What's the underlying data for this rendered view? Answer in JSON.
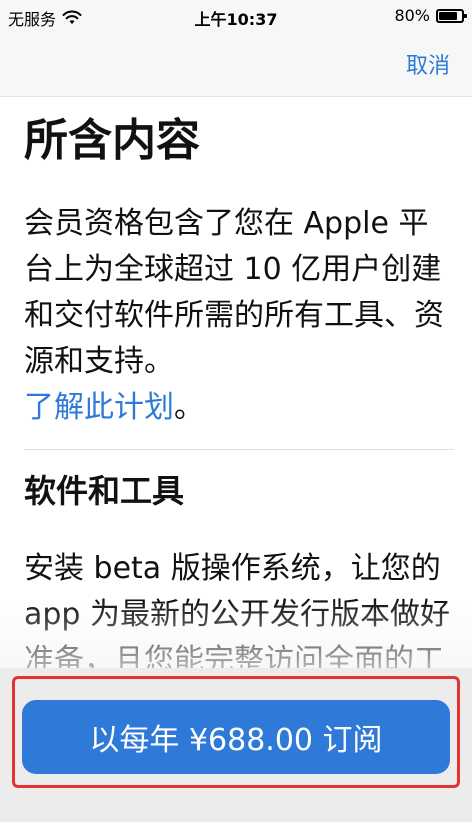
{
  "status_bar": {
    "carrier": "无服务",
    "time": "上午10:37",
    "battery": "80%",
    "battery_level": 0.8
  },
  "nav": {
    "cancel_label": "取消"
  },
  "content": {
    "title": "所含内容",
    "intro_paragraph": "会员资格包含了您在 Apple 平台上为全球超过 10 亿用户创建和交付软件所需的所有工具、资源和支持。",
    "learn_more_link": "了解此计划",
    "learn_more_suffix": "。",
    "software_heading": "软件和工具",
    "software_paragraph": "安装 beta 版操作系统，让您的 app 为最新的公开发行版本做好准备，且您能完整访问全面的工具来配置 app 服"
  },
  "subscribe": {
    "button_label": "以每年 ¥688.00 订阅"
  },
  "colors": {
    "accent": "#2f7ad8",
    "highlight": "#e53131"
  }
}
